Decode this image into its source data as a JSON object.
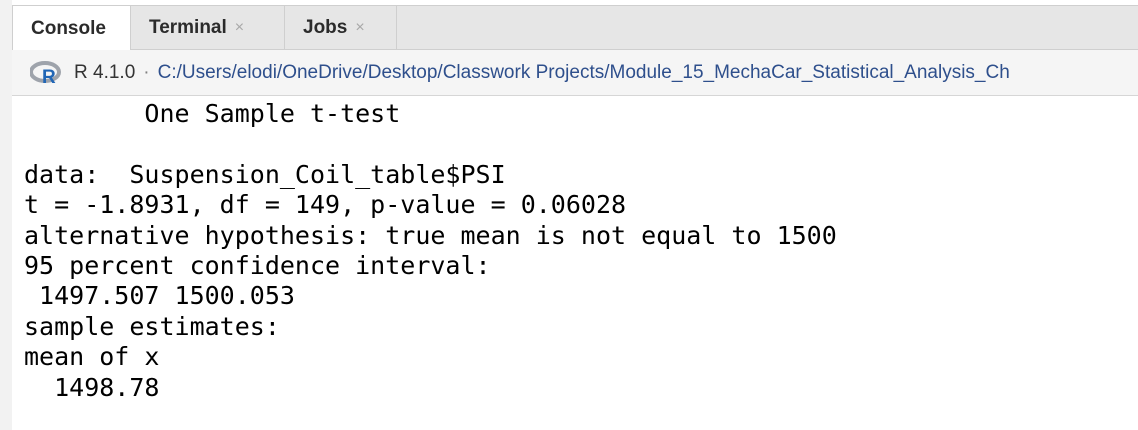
{
  "tabs": [
    {
      "label": "Console",
      "active": true,
      "closable": false
    },
    {
      "label": "Terminal",
      "active": false,
      "closable": true
    },
    {
      "label": "Jobs",
      "active": false,
      "closable": true
    }
  ],
  "close_glyph": "×",
  "pathbar": {
    "version": "R 4.1.0",
    "separator": "·",
    "path": "C:/Users/elodi/OneDrive/Desktop/Classwork Projects/Module_15_MechaCar_Statistical_Analysis_Ch"
  },
  "output": {
    "title": "        One Sample t-test",
    "blank1": " ",
    "data_line": "data:  Suspension_Coil_table$PSI",
    "stats_line": "t = -1.8931, df = 149, p-value = 0.06028",
    "alt_line": "alternative hypothesis: true mean is not equal to 1500",
    "ci_label": "95 percent confidence interval:",
    "ci_values": " 1497.507 1500.053",
    "est_label": "sample estimates:",
    "est_header": "mean of x",
    "est_value": "  1498.78"
  },
  "colors": {
    "tab_bar": "#e6e6e6",
    "path_text": "#2e4f8c",
    "r_logo_blue": "#2166b5",
    "r_logo_ring": "#9ea3ab"
  },
  "icons": {
    "r_logo": "r-logo-icon",
    "tab_close": "close-icon"
  }
}
